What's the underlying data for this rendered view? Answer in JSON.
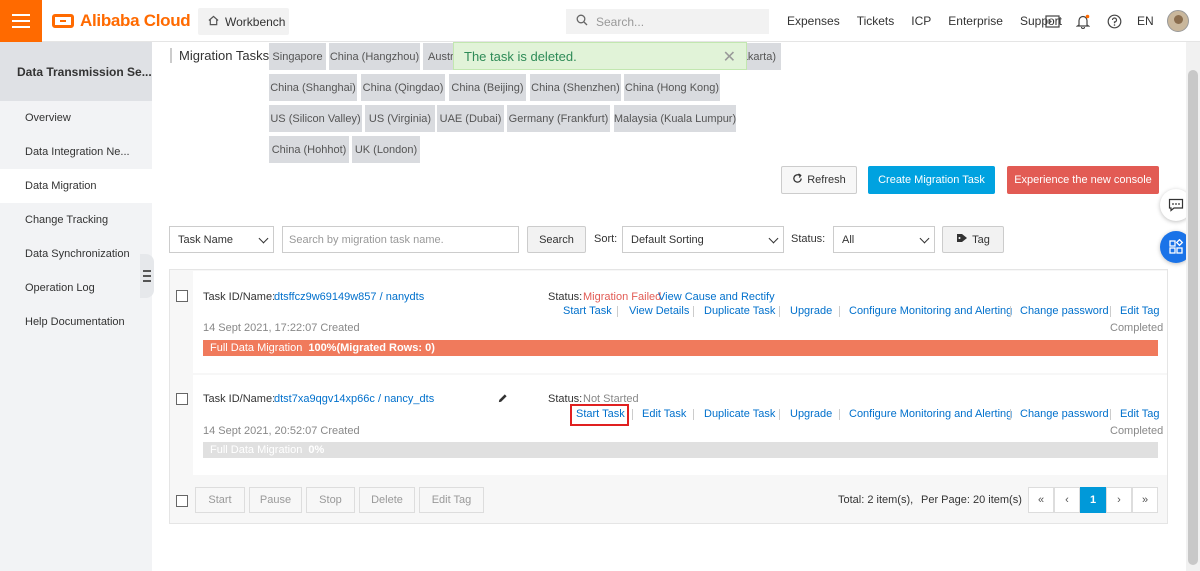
{
  "topbar": {
    "logo_text": "Alibaba Cloud",
    "workbench_label": "Workbench",
    "search_placeholder": "Search...",
    "links": [
      "Expenses",
      "Tickets",
      "ICP",
      "Enterprise",
      "Support"
    ],
    "lang": "EN",
    "accent_color": "#ff6a00"
  },
  "sidebar": {
    "title": "Data Transmission Se...",
    "items": [
      "Overview",
      "Data Integration  Ne...",
      "Data Migration",
      "Change Tracking",
      "Data Synchronization",
      "Operation Log",
      "Help Documentation"
    ],
    "active_index": 2
  },
  "main": {
    "page_title": "Migration Tasks",
    "regions_row1": [
      "Singapore",
      "China (Hangzhou)",
      "Austr",
      "akarta)"
    ],
    "regions_row2": [
      "China (Shanghai)",
      "China (Qingdao)",
      "China (Beijing)",
      "China (Shenzhen)",
      "China (Hong Kong)"
    ],
    "regions_row3": [
      "US (Silicon Valley)",
      "US (Virginia)",
      "UAE (Dubai)",
      "Germany (Frankfurt)",
      "Malaysia (Kuala Lumpur)"
    ],
    "regions_row4": [
      "China (Hohhot)",
      "UK (London)"
    ],
    "toast": "The task is deleted.",
    "buttons": {
      "refresh": "Refresh",
      "create": "Create Migration Task",
      "experience": "Experience the new console"
    },
    "filters": {
      "task_field": "Task Name",
      "search_placeholder": "Search by migration task name.",
      "search_button": "Search",
      "sort_label": "Sort:",
      "sort_value": "Default Sorting",
      "status_label": "Status:",
      "status_value": "All",
      "tag_button": "Tag"
    },
    "tasks": [
      {
        "id_label": "Task ID/Name:",
        "id": "dtsffcz9w69149w857 / nanydts",
        "status_label": "Status:",
        "status": "Migration Failed",
        "status_extra": "View Cause and Rectify",
        "actions": [
          "Start Task",
          "View Details",
          "Duplicate Task",
          "Upgrade",
          "Configure Monitoring and Alerting",
          "Change password",
          "Edit Tag"
        ],
        "created": "14 Sept 2021, 17:22:07  Created",
        "state": "Completed",
        "progress_label": "Full Data Migration",
        "progress_value": "100%(Migrated Rows: 0)",
        "progress_fraction": 1.0,
        "progress_color": "#f07a5c"
      },
      {
        "id_label": "Task ID/Name:",
        "id": "dtst7xa9qgv14xp66c / nancy_dts",
        "status_label": "Status:",
        "status": "Not Started",
        "actions": [
          "Start Task",
          "Edit Task",
          "Duplicate Task",
          "Upgrade",
          "Configure Monitoring and Alerting",
          "Change password",
          "Edit Tag"
        ],
        "created": "14 Sept 2021, 20:52:07  Created",
        "state": "Completed",
        "progress_label": "Full Data Migration",
        "progress_value": "0%",
        "progress_fraction": 0.0,
        "progress_color": "#e0e0e0"
      }
    ],
    "footer": {
      "bulk_buttons": [
        "Start",
        "Pause",
        "Stop",
        "Delete",
        "Edit Tag"
      ],
      "total": "Total: 2 item(s),",
      "per_page": "Per Page: 20 item(s)",
      "pager": [
        "«",
        "‹",
        "1",
        "›",
        "»"
      ],
      "current_page": "1"
    }
  }
}
